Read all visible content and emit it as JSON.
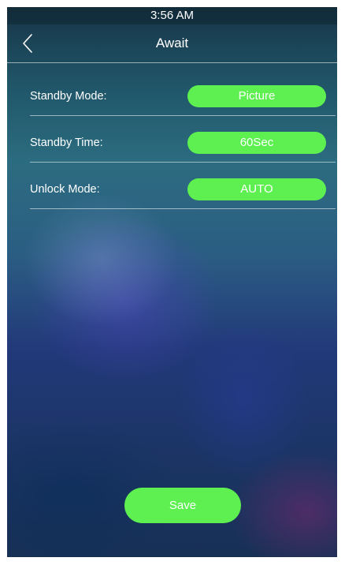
{
  "status_bar": {
    "time": "3:56 AM"
  },
  "header": {
    "title": "Await",
    "back_icon": "chevron-left-icon"
  },
  "settings": [
    {
      "label": "Standby Mode:",
      "value": "Picture"
    },
    {
      "label": "Standby Time:",
      "value": "60Sec"
    },
    {
      "label": "Unlock Mode:",
      "value": "AUTO"
    }
  ],
  "save_label": "Save",
  "colors": {
    "accent_green": "#5ef050",
    "text": "#ffffff"
  }
}
